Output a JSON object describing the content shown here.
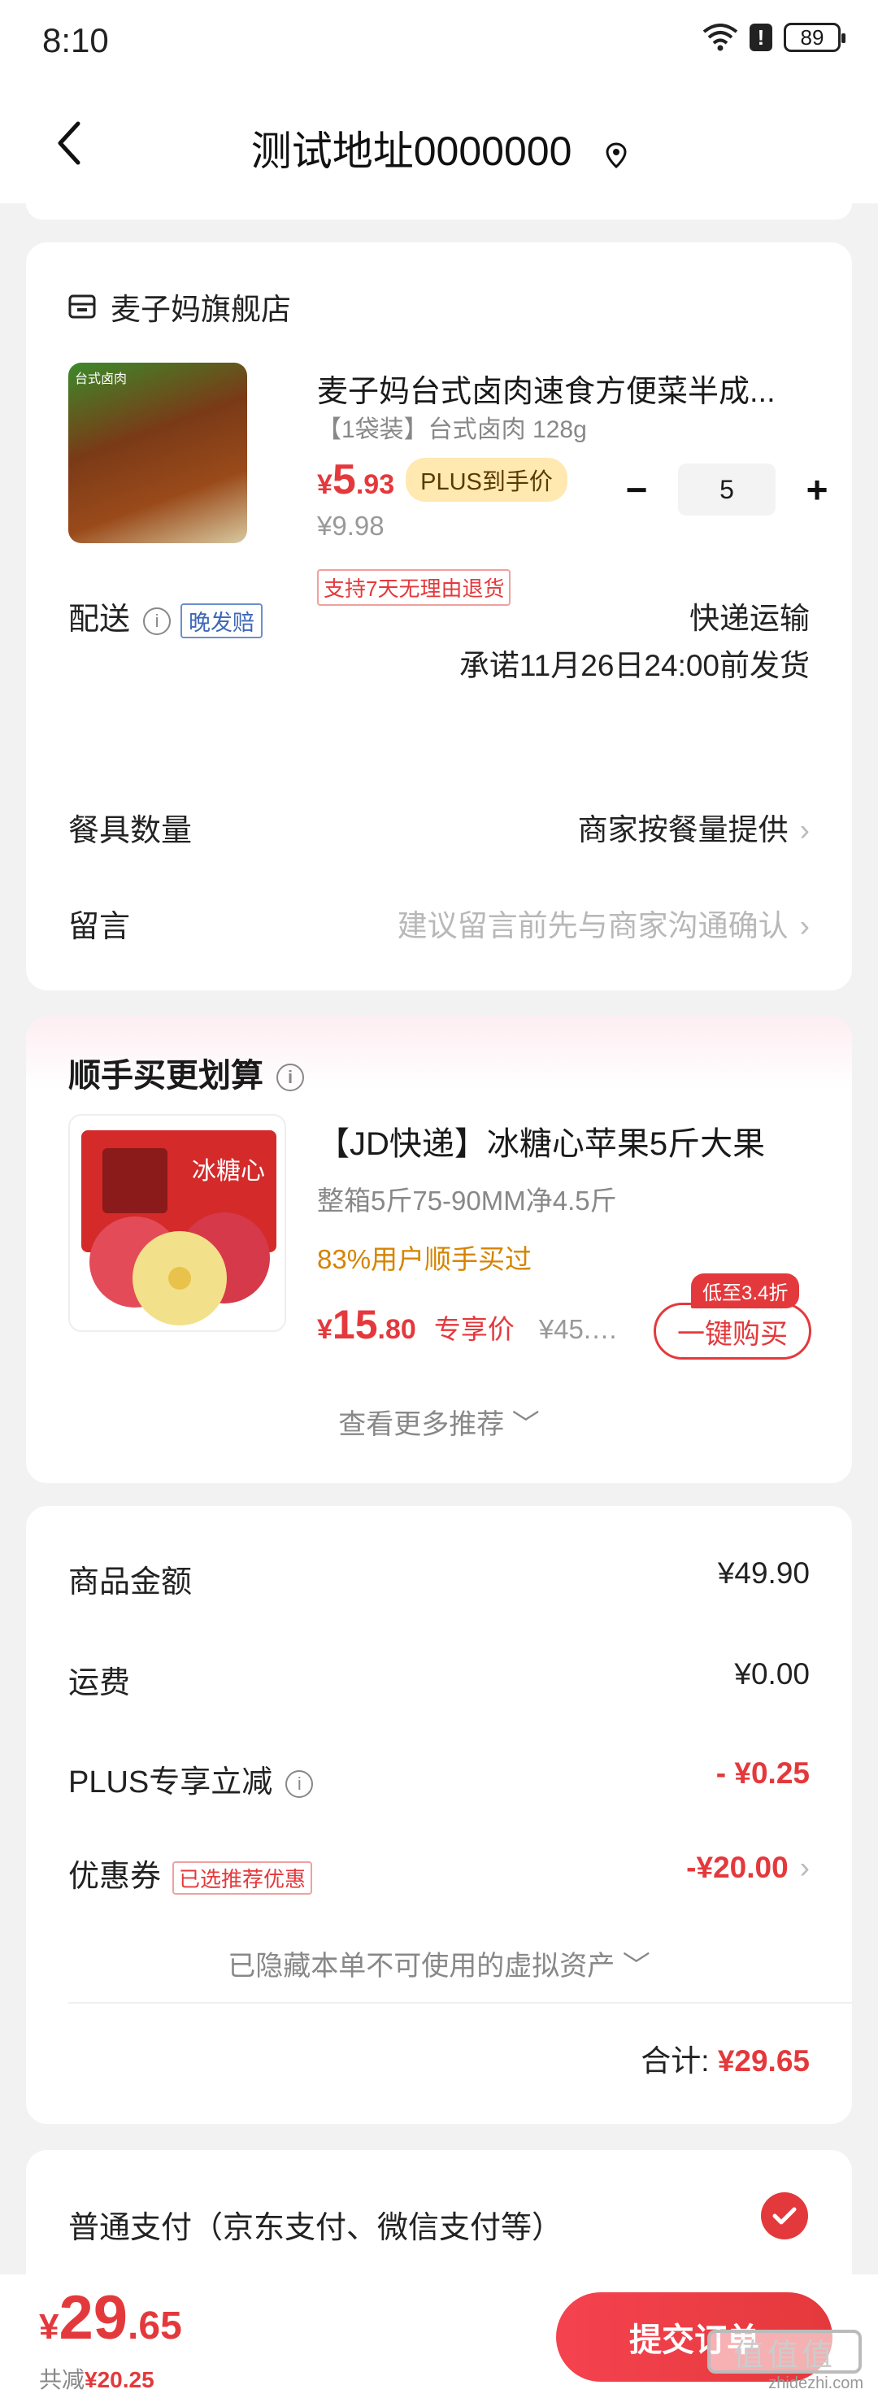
{
  "statusbar": {
    "time": "8:10",
    "battery": "89"
  },
  "header": {
    "title": "测试地址0000000"
  },
  "store": {
    "name": "麦子妈旗舰店"
  },
  "product": {
    "image_tag": "台式卤肉",
    "title": "麦子妈台式卤肉速食方便菜半成...",
    "spec": "【1袋装】台式卤肉 128g",
    "price_symbol": "¥",
    "price_int": "5",
    "price_dec": ".93",
    "plus_label": "PLUS到手价",
    "original_price": "¥9.98",
    "return_policy": "支持7天无理由退货",
    "quantity": "5"
  },
  "delivery": {
    "label": "配送",
    "tag": "晚发赔",
    "method": "快递运输",
    "promise": "承诺11月26日24:00前发货"
  },
  "tableware": {
    "label": "餐具数量",
    "value": "商家按餐量提供"
  },
  "note": {
    "label": "留言",
    "placeholder": "建议留言前先与商家沟通确认"
  },
  "recommend": {
    "title": "顺手买更划算",
    "name": "【JD快递】冰糖心苹果5斤大果",
    "spec": "整箱5斤75-90MM净4.5斤",
    "users": "83%用户顺手买过",
    "price_symbol": "¥",
    "price_int": "15",
    "price_dec": ".80",
    "price_tag": "专享价",
    "original_price": "¥45.…",
    "discount": "低至3.4折",
    "buy_label": "一键购买",
    "image_text": "冰糖心",
    "more": "查看更多推荐"
  },
  "summary": {
    "goods_label": "商品金额",
    "goods_value": "¥49.90",
    "shipping_label": "运费",
    "shipping_value": "¥0.00",
    "plus_label": "PLUS专享立减",
    "plus_value": "- ¥0.25",
    "coupon_label": "优惠券",
    "coupon_tag": "已选推荐优惠",
    "coupon_value": "-¥20.00",
    "hidden_assets": "已隐藏本单不可使用的虚拟资产",
    "total_label": "合计:",
    "total_value": "¥29.65"
  },
  "payment": {
    "label": "普通支付（京东支付、微信支付等）"
  },
  "bottom": {
    "price_symbol": "¥",
    "price_int": "29",
    "price_dec": ".65",
    "save_label": "共减",
    "save_value": "¥20.25",
    "submit": "提交订单",
    "watermark": "zhidezhi.com",
    "watermark_logo": "值值值"
  },
  "colors": {
    "accent": "#e4393c",
    "plus_badge": "#ffe9b0",
    "recommend_users": "#d68400"
  }
}
